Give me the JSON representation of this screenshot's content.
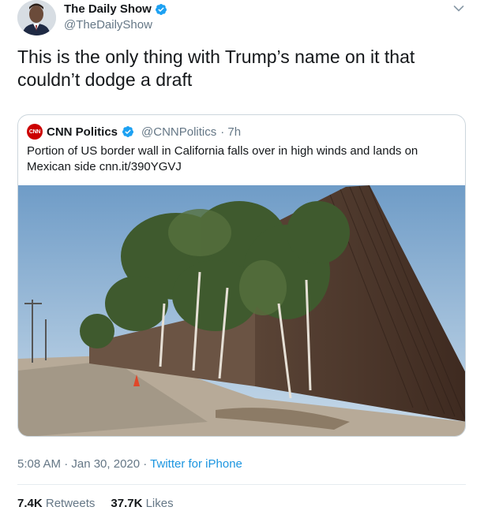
{
  "author": {
    "name": "The Daily Show",
    "handle": "@TheDailyShow",
    "verified": true,
    "avatar_icon": "avatar-photo"
  },
  "tweet": {
    "text": "This is the only thing with Trump’s name on it that couldn’t dodge a draft"
  },
  "quoted": {
    "name": "CNN Politics",
    "logo_text": "CNN",
    "handle": "@CNNPolitics",
    "age": "· 7h",
    "text": "Portion of US border wall in California falls over in high winds and lands on Mexican side cnn.it/390YGVJ"
  },
  "meta": {
    "time": "5:08 AM · Jan 30, 2020 · ",
    "source": "Twitter for iPhone"
  },
  "stats": {
    "retweets_count": "7.4K",
    "retweets_label": "Retweets",
    "likes_count": "37.7K",
    "likes_label": "Likes"
  },
  "colors": {
    "accent": "#1da1f2",
    "link": "#1b95e0",
    "secondary_text": "#657786",
    "cnn_red": "#cc0000"
  }
}
